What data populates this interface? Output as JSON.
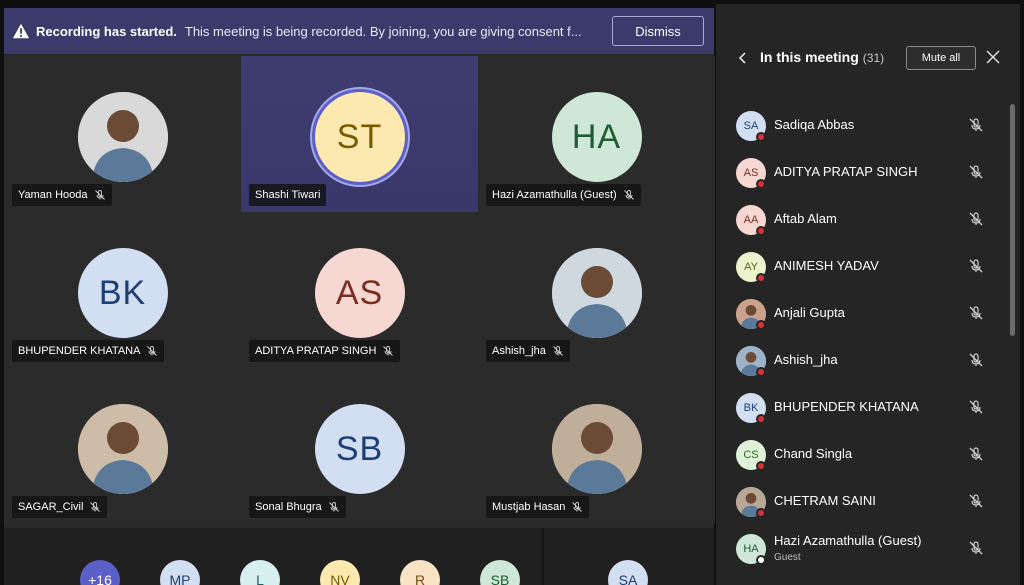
{
  "banner": {
    "title": "Recording has started.",
    "message": "This meeting is being recorded. By joining, you are giving consent f...",
    "dismiss_label": "Dismiss"
  },
  "tiles": [
    {
      "name": "Yaman Hooda",
      "initials": "",
      "photo": true,
      "bg": "#d9d9d9",
      "fg": "#333"
    },
    {
      "name": "Shashi Tiwari",
      "initials": "ST",
      "photo": false,
      "bg": "#fbe9b0",
      "fg": "#7a5a00",
      "active": true
    },
    {
      "name": "Hazi Azamathulla (Guest)",
      "initials": "HA",
      "photo": false,
      "bg": "#cfe7d6",
      "fg": "#1f5c33"
    },
    {
      "name": "BHUPENDER KHATANA",
      "initials": "BK",
      "photo": false,
      "bg": "#d2dff2",
      "fg": "#1e3f73"
    },
    {
      "name": "ADITYA PRATAP SINGH",
      "initials": "AS",
      "photo": false,
      "bg": "#f6d7d2",
      "fg": "#7a2d22"
    },
    {
      "name": "Ashish_jha",
      "initials": "",
      "photo": true,
      "bg": "#cfd7df",
      "fg": "#333"
    },
    {
      "name": "SAGAR_Civil",
      "initials": "",
      "photo": true,
      "bg": "#cdbca8",
      "fg": "#333"
    },
    {
      "name": "Sonal Bhugra",
      "initials": "SB",
      "photo": false,
      "bg": "#d2dff2",
      "fg": "#1e3f73"
    },
    {
      "name": "Mustjab Hasan",
      "initials": "",
      "photo": true,
      "bg": "#bfae9a",
      "fg": "#333"
    }
  ],
  "strip": [
    {
      "label": "+16",
      "bg": "#5b5fc7",
      "fg": "#fff"
    },
    {
      "label": "MP",
      "bg": "#d2dff2",
      "fg": "#1e3f73"
    },
    {
      "label": "L",
      "bg": "#d7efef",
      "fg": "#1f6060"
    },
    {
      "label": "NV",
      "bg": "#fbe9b0",
      "fg": "#7a5a00"
    },
    {
      "label": "R",
      "bg": "#f8e3c5",
      "fg": "#7a4a10"
    },
    {
      "label": "SB",
      "bg": "#cfe7d6",
      "fg": "#1f5c33"
    },
    {
      "label": "SA",
      "bg": "#d2dff2",
      "fg": "#1e3f73"
    }
  ],
  "panel": {
    "title": "In this meeting",
    "count": "(31)",
    "mute_all_label": "Mute all",
    "participants": [
      {
        "name": "Sadiqa Abbas",
        "initials": "SA",
        "bg": "#d2dff2",
        "fg": "#1e3f73",
        "photo": false,
        "sub": ""
      },
      {
        "name": "ADITYA PRATAP SINGH",
        "initials": "AS",
        "bg": "#f6d7d2",
        "fg": "#7a2d22",
        "photo": false,
        "sub": ""
      },
      {
        "name": "Aftab Alam",
        "initials": "AA",
        "bg": "#f6d7d2",
        "fg": "#7a2d22",
        "photo": false,
        "sub": ""
      },
      {
        "name": "ANIMESH YADAV",
        "initials": "AY",
        "bg": "#eef3cf",
        "fg": "#5a6310",
        "photo": false,
        "sub": ""
      },
      {
        "name": "Anjali Gupta",
        "initials": "",
        "bg": "#c9a38b",
        "fg": "#333",
        "photo": true,
        "sub": ""
      },
      {
        "name": "Ashish_jha",
        "initials": "",
        "bg": "#9fb3c8",
        "fg": "#333",
        "photo": true,
        "sub": ""
      },
      {
        "name": "BHUPENDER KHATANA",
        "initials": "BK",
        "bg": "#d2dff2",
        "fg": "#1e3f73",
        "photo": false,
        "sub": ""
      },
      {
        "name": "Chand Singla",
        "initials": "CS",
        "bg": "#dff2d7",
        "fg": "#2f6a1f",
        "photo": false,
        "sub": ""
      },
      {
        "name": "CHETRAM SAINI",
        "initials": "",
        "bg": "#b7a797",
        "fg": "#333",
        "photo": true,
        "sub": ""
      },
      {
        "name": "Hazi Azamathulla (Guest)",
        "initials": "HA",
        "bg": "#cfe7d6",
        "fg": "#1f5c33",
        "photo": false,
        "sub": "Guest"
      }
    ]
  }
}
